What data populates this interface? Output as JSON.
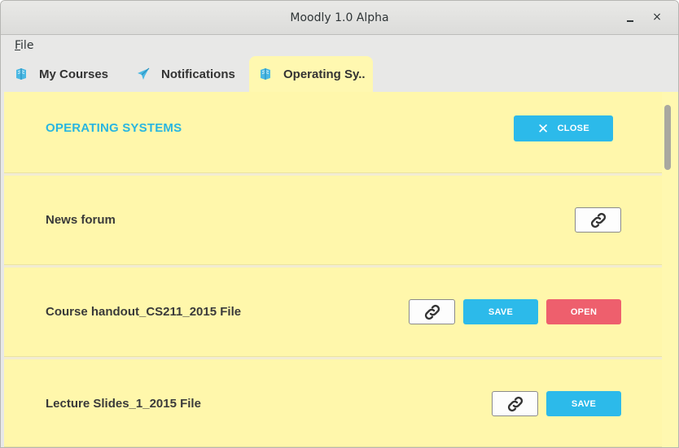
{
  "window": {
    "title": "Moodly 1.0 Alpha",
    "minimize_glyph": "",
    "close_glyph": "×"
  },
  "menubar": {
    "file_underlined": "F",
    "file_rest": "ile"
  },
  "tabs": [
    {
      "label": "My Courses",
      "icon": "book-icon",
      "active": false
    },
    {
      "label": "Notifications",
      "icon": "paper-plane-icon",
      "active": false
    },
    {
      "label": "Operating Sy..",
      "icon": "book-icon",
      "active": true
    }
  ],
  "course": {
    "title": "OPERATING SYSTEMS",
    "close_label": "CLOSE"
  },
  "items": [
    {
      "label": "News forum",
      "actions": [
        "link"
      ]
    },
    {
      "label": "Course handout_CS211_2015 File",
      "actions": [
        "link",
        "save",
        "open"
      ],
      "save_label": "SAVE",
      "open_label": "OPEN"
    },
    {
      "label": "Lecture Slides_1_2015 File",
      "actions": [
        "link",
        "save"
      ],
      "save_label": "SAVE"
    }
  ],
  "colors": {
    "accent_blue": "#2cbaea",
    "open_red": "#ee5f6d",
    "content_bg": "#fff8b0"
  }
}
